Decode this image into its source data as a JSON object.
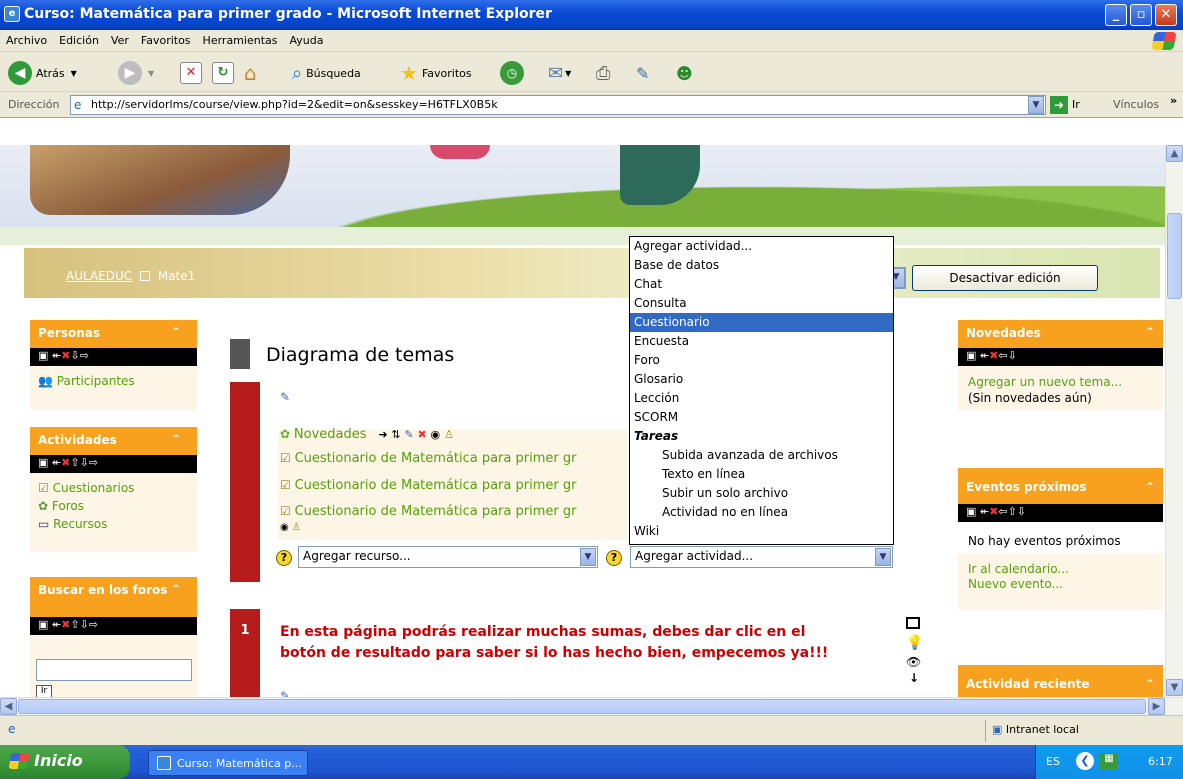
{
  "window": {
    "title": "Curso: Matemática para primer grado - Microsoft Internet Explorer"
  },
  "menu": [
    "Archivo",
    "Edición",
    "Ver",
    "Favoritos",
    "Herramientas",
    "Ayuda"
  ],
  "toolbar": {
    "back": "Atrás",
    "search": "Búsqueda",
    "favorites": "Favoritos"
  },
  "address": {
    "label": "Dirección",
    "url": "http://servidorlms/course/view.php?id=2&edit=on&sesskey=H6TFLX0B5k",
    "go": "Ir",
    "links": "Vínculos"
  },
  "nav": {
    "site": "AULAEDUC",
    "course": "Mate1",
    "edit_button": "Desactivar edición"
  },
  "left_blocks": {
    "personas": {
      "title": "Personas",
      "link": "Participantes"
    },
    "actividades": {
      "title": "Actividades",
      "links": [
        "Cuestionarios",
        "Foros",
        "Recursos"
      ]
    },
    "buscar": {
      "title": "Buscar en los foros",
      "button": "Ir"
    }
  },
  "main": {
    "heading": "Diagrama de temas",
    "section0": {
      "items": [
        "Novedades",
        "Cuestionario de Matemática para primer gr",
        "Cuestionario de Matemática para primer gr",
        "Cuestionario de Matemática para primer gr"
      ],
      "add_resource": "Agregar recurso...",
      "add_activity": "Agregar actividad..."
    },
    "section1": {
      "number": "1",
      "text": "En esta página podrás realizar muchas sumas, debes dar clic en el botón de resultado para saber si lo has hecho bien, empecemos ya!!!"
    }
  },
  "dropdown": {
    "options": [
      {
        "label": "Agregar actividad...",
        "kind": "normal"
      },
      {
        "label": "Base de datos",
        "kind": "normal"
      },
      {
        "label": "Chat",
        "kind": "normal"
      },
      {
        "label": "Consulta",
        "kind": "normal"
      },
      {
        "label": "Cuestionario",
        "kind": "selected"
      },
      {
        "label": "Encuesta",
        "kind": "normal"
      },
      {
        "label": "Foro",
        "kind": "normal"
      },
      {
        "label": "Glosario",
        "kind": "normal"
      },
      {
        "label": "Lección",
        "kind": "normal"
      },
      {
        "label": "SCORM",
        "kind": "normal"
      },
      {
        "label": "Tareas",
        "kind": "group"
      },
      {
        "label": "Subida avanzada de archivos",
        "kind": "indent"
      },
      {
        "label": "Texto en línea",
        "kind": "indent"
      },
      {
        "label": "Subir un solo archivo",
        "kind": "indent"
      },
      {
        "label": "Actividad no en línea",
        "kind": "indent"
      },
      {
        "label": "Wiki",
        "kind": "normal"
      }
    ]
  },
  "right_blocks": {
    "novedades": {
      "title": "Novedades",
      "link": "Agregar un nuevo tema...",
      "note": "(Sin novedades aún)"
    },
    "eventos": {
      "title": "Eventos próximos",
      "empty": "No hay eventos próximos",
      "calendar": "Ir al calendario...",
      "new_event": "Nuevo evento..."
    },
    "reciente": {
      "title": "Actividad reciente"
    }
  },
  "status": {
    "zone": "Intranet local"
  },
  "taskbar": {
    "start": "Inicio",
    "task": "Curso: Matemática p...",
    "lang": "ES",
    "time": "6:17"
  }
}
